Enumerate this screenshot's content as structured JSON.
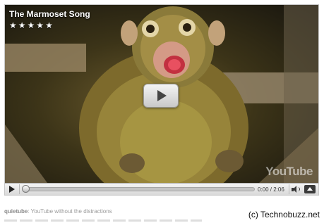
{
  "video": {
    "title": "The Marmoset Song",
    "rating": {
      "value": 5,
      "max": 5
    },
    "watermark": "YouTube"
  },
  "controls": {
    "current_time": "0:00",
    "time_separator": " / ",
    "duration": "2:06",
    "progress": 0
  },
  "footer": {
    "brand": "quietube",
    "tagline": ": YouTube without the distractions",
    "copyright": "(c) Technobuzz.net"
  },
  "icons": {
    "big_play": "play-icon",
    "play": "play-icon",
    "volume": "volume-icon",
    "expand": "expand-icon",
    "star": "star-icon"
  },
  "colors": {
    "video_background": "#1c1a12",
    "control_bar": "#e6e6e6",
    "text_dark": "#111111",
    "text_muted": "#9a9a9a"
  }
}
